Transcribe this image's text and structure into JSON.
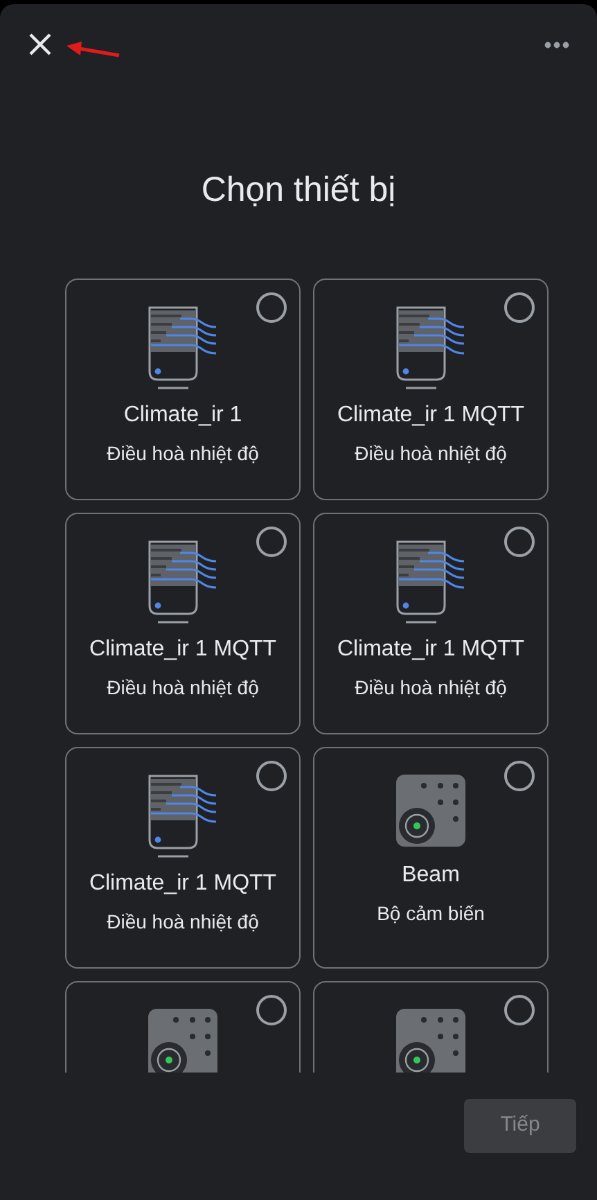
{
  "title": "Chọn thiết bị",
  "devices": [
    {
      "kind": "climate",
      "name": "Climate_ir 1",
      "type": "Điều hoà nhiệt độ",
      "selected": false
    },
    {
      "kind": "climate",
      "name": "Climate_ir 1 MQTT",
      "type": "Điều hoà nhiệt độ",
      "selected": false
    },
    {
      "kind": "climate",
      "name": "Climate_ir 1 MQTT",
      "type": "Điều hoà nhiệt độ",
      "selected": false
    },
    {
      "kind": "climate",
      "name": "Climate_ir 1 MQTT",
      "type": "Điều hoà nhiệt độ",
      "selected": false
    },
    {
      "kind": "climate",
      "name": "Climate_ir 1 MQTT",
      "type": "Điều hoà nhiệt độ",
      "selected": false
    },
    {
      "kind": "sensor",
      "name": "Beam",
      "type": "Bộ cảm biến",
      "selected": false
    },
    {
      "kind": "sensor",
      "selected": false
    },
    {
      "kind": "sensor",
      "selected": false
    }
  ],
  "next_button": {
    "label": "Tiếp",
    "disabled": true
  }
}
